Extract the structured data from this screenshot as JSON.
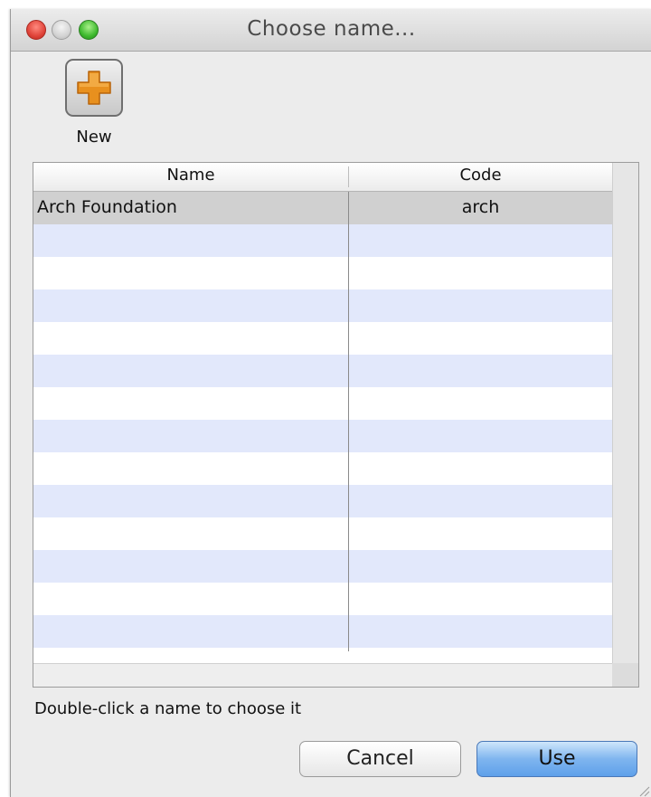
{
  "window": {
    "title": "Choose name..."
  },
  "toolbar": {
    "new_label": "New"
  },
  "table": {
    "columns": [
      "Name",
      "Code"
    ],
    "rows": [
      {
        "name": "Arch Foundation",
        "code": "arch",
        "selected": true
      }
    ]
  },
  "hint": "Double-click a name to choose it",
  "buttons": {
    "cancel": "Cancel",
    "use": "Use"
  },
  "colors": {
    "stripe": "#e2e8fb",
    "selected_row": "#d0d0d0",
    "plus_icon": "#e8901e",
    "default_button": "#7fb5ef"
  }
}
